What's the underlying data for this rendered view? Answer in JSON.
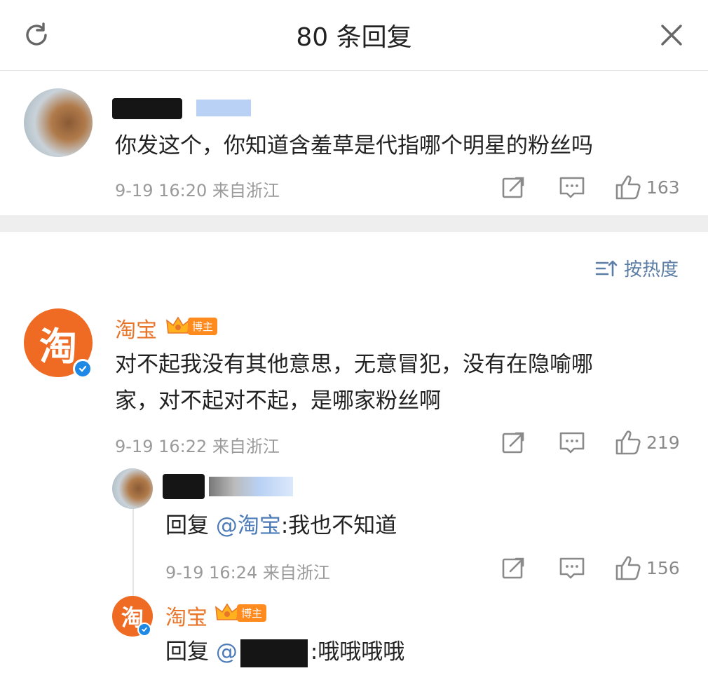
{
  "header": {
    "title": "80 条回复",
    "refresh_icon": "refresh-icon",
    "close_icon": "close-icon"
  },
  "root_comment": {
    "text": "你发这个，你知道含羞草是代指哪个明星的粉丝吗",
    "meta": "9-19 16:20 来自浙江",
    "likes": "163"
  },
  "sort": {
    "label": "按热度",
    "icon": "sort-icon"
  },
  "replies": [
    {
      "author": "淘宝",
      "badge": "博主",
      "text_line1": "对不起我没有其他意思，无意冒犯，没有在隐喻哪",
      "text_line2": "家，对不起对不起，是哪家粉丝啊",
      "meta": "9-19 16:22 来自浙江",
      "likes": "219",
      "avatar_char": "淘"
    }
  ],
  "sub_replies": [
    {
      "reply_prefix": "回复",
      "mention": "@淘宝",
      "text": ":我也不知道",
      "meta": "9-19 16:24 来自浙江",
      "likes": "156"
    },
    {
      "author": "淘宝",
      "badge": "博主",
      "reply_prefix": "回复",
      "mention": "@",
      "text": ":哦哦哦哦",
      "avatar_char": "淘"
    }
  ],
  "colors": {
    "accent_orange": "#e8762a",
    "link_blue": "#4c7bb7",
    "meta_gray": "#9a9a9a"
  }
}
